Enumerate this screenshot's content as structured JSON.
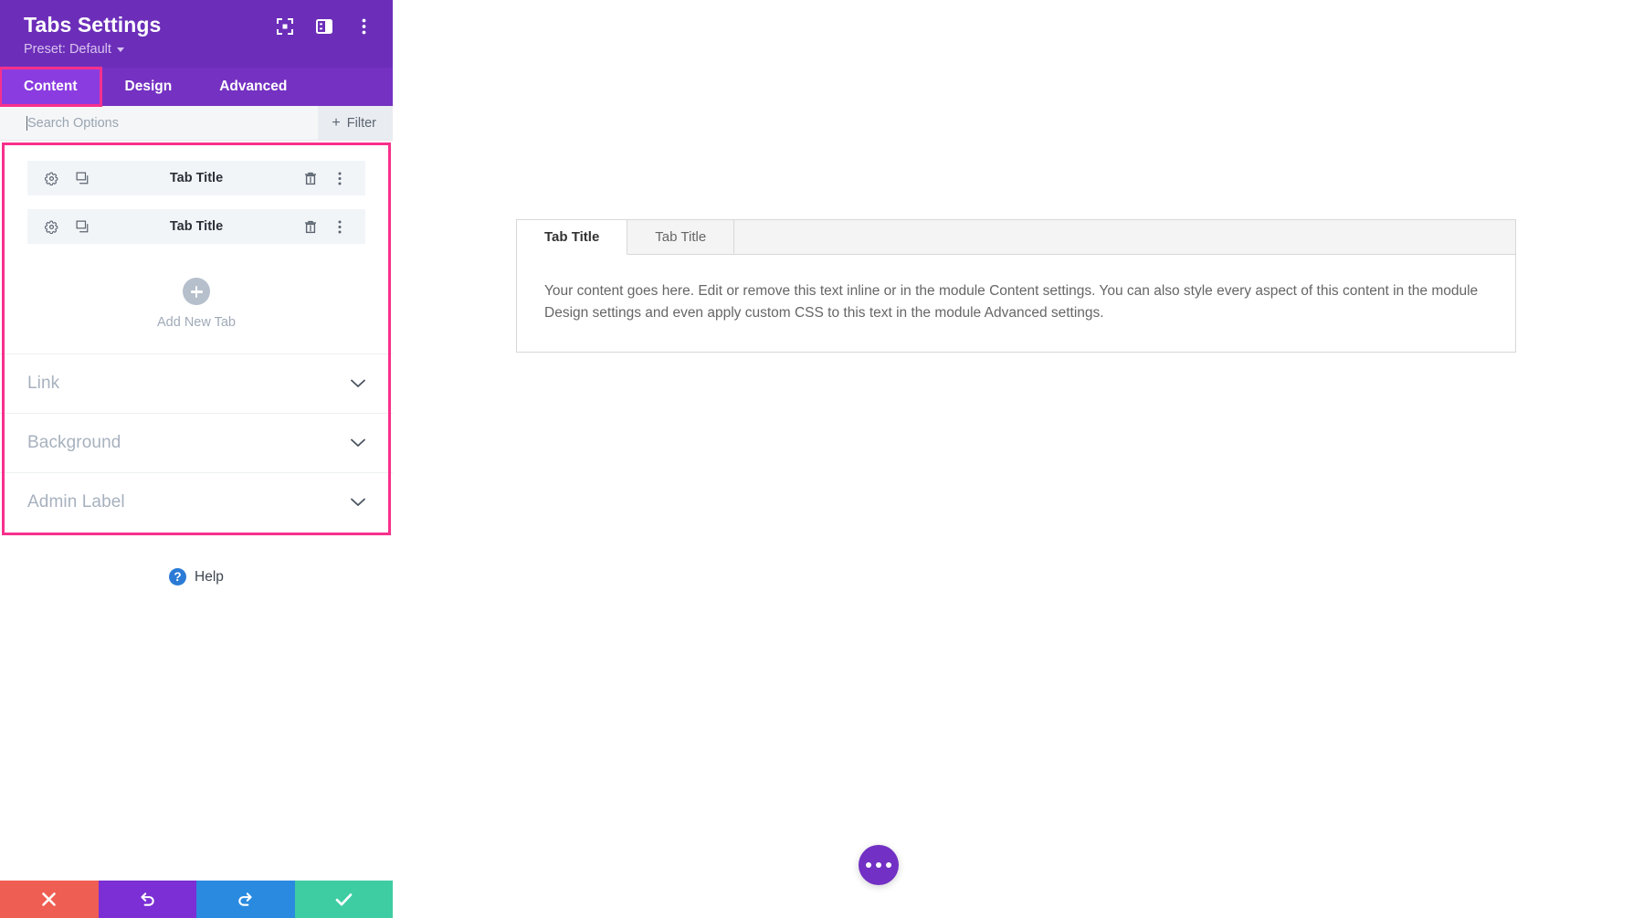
{
  "panel": {
    "title": "Tabs Settings",
    "preset_label": "Preset: Default",
    "header_icons": [
      {
        "name": "focus-target-icon",
        "label": "Focus"
      },
      {
        "name": "layout-panel-icon",
        "label": "Panel Layout"
      },
      {
        "name": "vertical-dots-icon",
        "label": "More Options"
      }
    ],
    "tabs": [
      {
        "label": "Content",
        "active": true,
        "highlighted": true
      },
      {
        "label": "Design",
        "active": false,
        "highlighted": false
      },
      {
        "label": "Advanced",
        "active": false,
        "highlighted": false
      }
    ],
    "search": {
      "placeholder": "Search Options",
      "value": ""
    },
    "filter_label": "Filter",
    "tab_items": [
      {
        "title": "Tab Title"
      },
      {
        "title": "Tab Title"
      }
    ],
    "add_new_label": "Add New Tab",
    "accordions": [
      {
        "label": "Link"
      },
      {
        "label": "Background"
      },
      {
        "label": "Admin Label"
      }
    ],
    "help_label": "Help",
    "actions": [
      {
        "name": "cancel-button",
        "icon": "close-icon",
        "color": "#EF5E53"
      },
      {
        "name": "undo-button",
        "icon": "undo-icon",
        "color": "#7B2FD4"
      },
      {
        "name": "redo-button",
        "icon": "redo-icon",
        "color": "#2A8AE0"
      },
      {
        "name": "save-button",
        "icon": "check-icon",
        "color": "#3ECCA3"
      }
    ],
    "colors": {
      "header_bg": "#6C2EB9",
      "tabstrip_bg": "#7531C2",
      "tab_active_bg": "#8B3CE0",
      "highlight_border": "#F8308C",
      "accent": "#7230C4"
    }
  },
  "preview": {
    "tabs": [
      {
        "label": "Tab Title",
        "active": true
      },
      {
        "label": "Tab Title",
        "active": false
      }
    ],
    "content_text": "Your content goes here. Edit or remove this text inline or in the module Content settings. You can also style every aspect of this content in the module Design settings and even apply custom CSS to this text in the module Advanced settings."
  }
}
